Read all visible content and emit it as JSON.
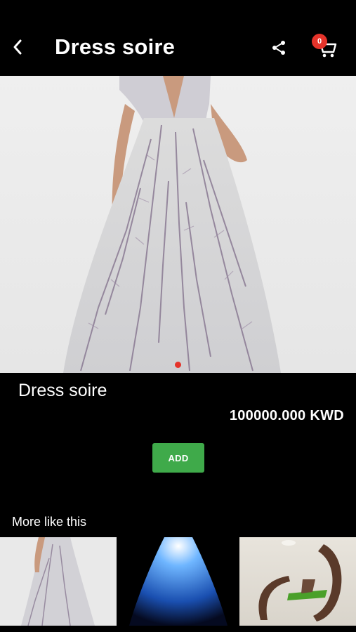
{
  "header": {
    "title": "Dress soire",
    "cart_count": "0"
  },
  "product": {
    "name": "Dress soire",
    "price": "100000.000 KWD",
    "add_label": "ADD",
    "image_count_dots": 1
  },
  "more": {
    "title": "More like this"
  },
  "icons": {
    "back": "chevron-left-icon",
    "share": "share-icon",
    "cart": "cart-icon"
  },
  "colors": {
    "background": "#000000",
    "accent_red": "#e5332a",
    "add_green": "#3faa4a"
  }
}
